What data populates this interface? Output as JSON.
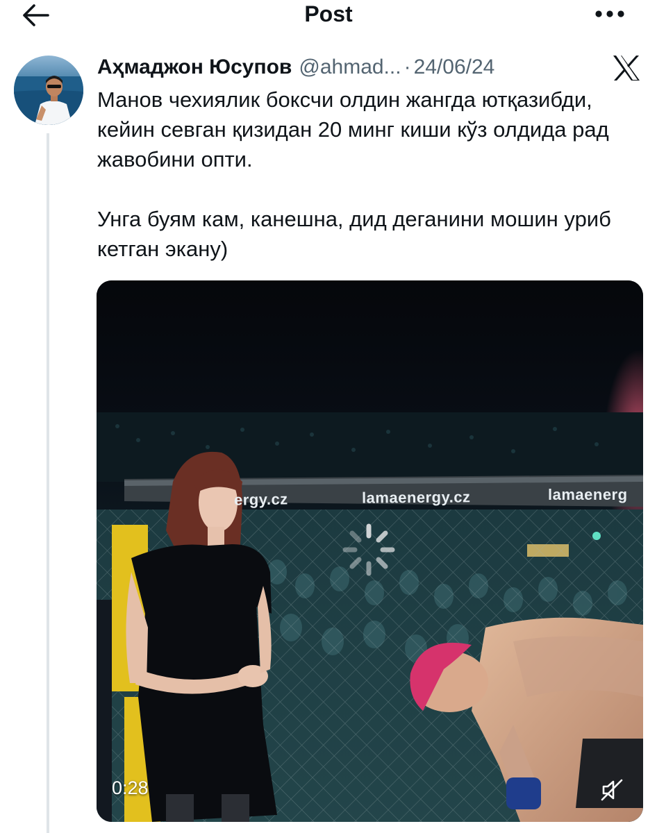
{
  "topbar": {
    "title": "Post",
    "back_icon": "arrow-left-icon",
    "more_icon": "more-horizontal-icon"
  },
  "post": {
    "author": {
      "display_name": "Аҳмаджон Юсупов",
      "handle": "@ahmad...",
      "avatar_icon": "user-avatar"
    },
    "separator": "·",
    "date": "24/06/24",
    "platform_icon": "x-logo-icon",
    "text_paragraph_1": "Манов чехиялик боксчи олдин жангда ютқазибди, кейин севган қизидан 20 минг киши кўз олдида рад жавобини опти.",
    "text_paragraph_2": "Унга буям кам, канешна, дид деганини мошин уриб кетган экану)"
  },
  "video": {
    "duration": "0:28",
    "banner_left": "ergy.cz",
    "banner_center": "lamaenergy.cz",
    "banner_right": "lamaenerg",
    "mute_icon": "muted-speaker-icon",
    "loading_icon": "loading-spinner-icon"
  },
  "colors": {
    "text_primary": "#0f1419",
    "text_secondary": "#536471",
    "thread_line": "#dfe4e8",
    "video_bg": "#0b0f14",
    "hair_pink": "#d6336c"
  }
}
